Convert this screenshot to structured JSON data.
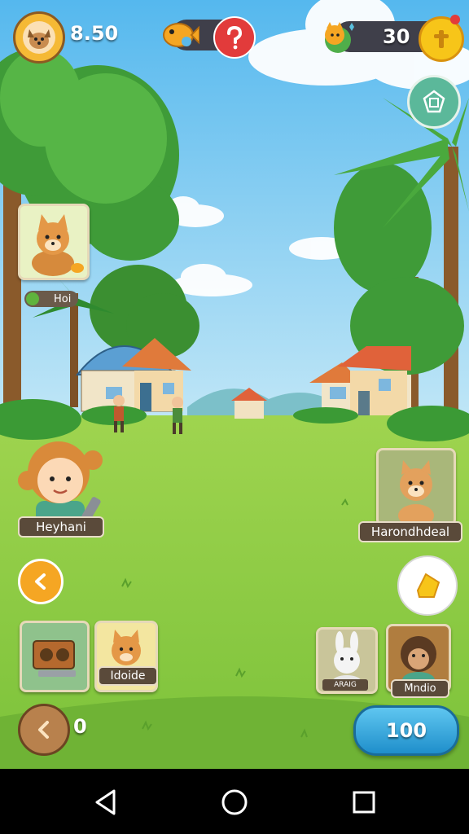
{
  "hud": {
    "coins": "8.50",
    "gems": "30"
  },
  "side_card_top": {
    "tag_label": "Hoi"
  },
  "characters": {
    "left_name": "Heyhani",
    "right_name": "Harondhdeal"
  },
  "bottom_cards": {
    "item2_label": "Idoide",
    "item3_label": "ARAIG",
    "item4_label": "Mndio"
  },
  "bottom_bar": {
    "back_count": "0",
    "action_value": "100"
  },
  "colors": {
    "sky": "#8fd0f2",
    "grass": "#88c944",
    "action_button": "#2aa6dc",
    "orange_button": "#f5a623"
  },
  "nav": {
    "back_icon": "triangle-back-icon",
    "home_icon": "circle-home-icon",
    "recent_icon": "square-recents-icon"
  }
}
